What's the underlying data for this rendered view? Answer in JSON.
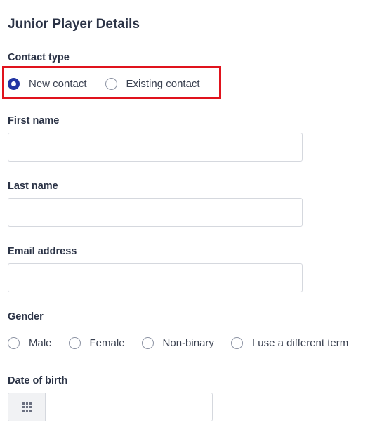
{
  "form": {
    "title": "Junior Player Details",
    "contact_type": {
      "label": "Contact type",
      "options": [
        "New contact",
        "Existing contact"
      ],
      "selected": "New contact"
    },
    "first_name": {
      "label": "First name",
      "value": "",
      "placeholder": ""
    },
    "last_name": {
      "label": "Last name",
      "value": "",
      "placeholder": ""
    },
    "email": {
      "label": "Email address",
      "value": "",
      "placeholder": ""
    },
    "gender": {
      "label": "Gender",
      "options": [
        "Male",
        "Female",
        "Non-binary",
        "I use a different term"
      ],
      "selected": null
    },
    "date_of_birth": {
      "label": "Date of birth",
      "value": "",
      "icon": "calendar-grid-icon"
    }
  },
  "colors": {
    "text": "#2b3346",
    "radio_selected": "#2336a3",
    "highlight": "#e0131d",
    "input_border": "#d5d8de"
  }
}
